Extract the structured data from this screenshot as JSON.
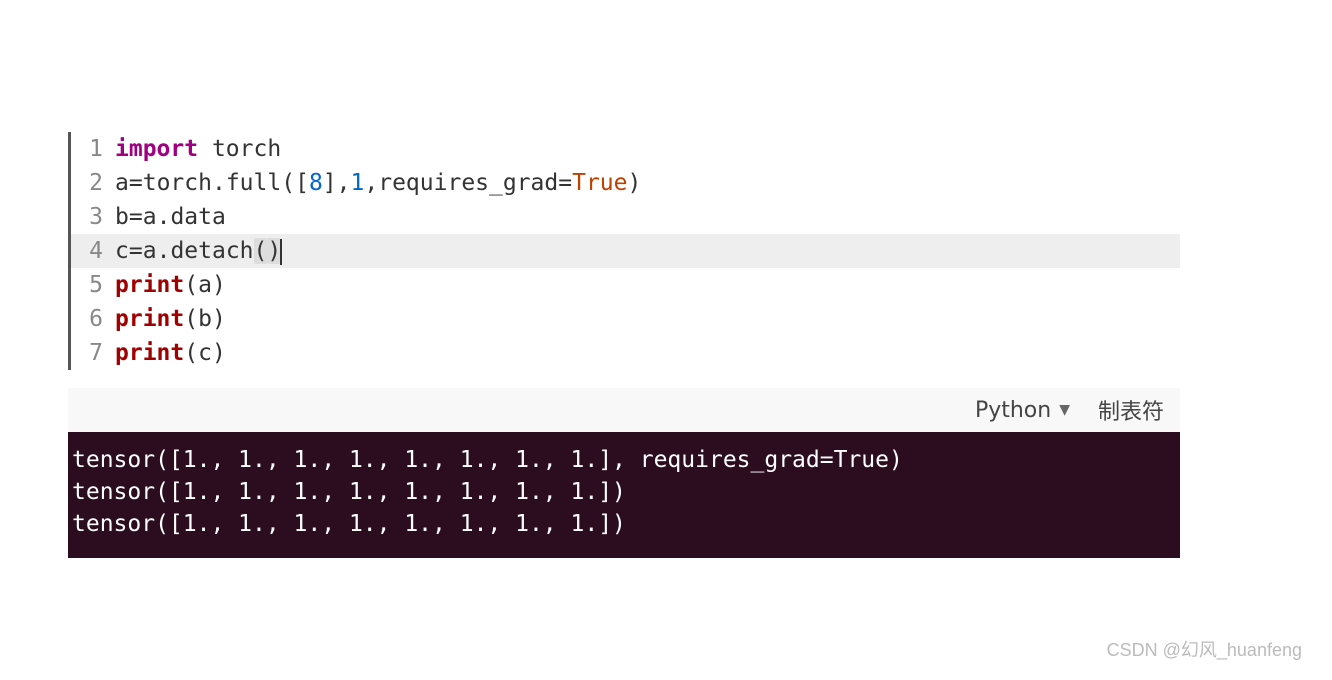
{
  "code": {
    "lines": [
      {
        "num": "1",
        "tokens": [
          {
            "t": "import ",
            "c": "kw-import"
          },
          {
            "t": "torch",
            "c": "ident"
          }
        ]
      },
      {
        "num": "2",
        "tokens": [
          {
            "t": "a",
            "c": "ident"
          },
          {
            "t": "=",
            "c": "eq"
          },
          {
            "t": "torch",
            "c": "ident"
          },
          {
            "t": ".",
            "c": "dot"
          },
          {
            "t": "full",
            "c": "ident"
          },
          {
            "t": "(",
            "c": "paren"
          },
          {
            "t": "[",
            "c": "paren"
          },
          {
            "t": "8",
            "c": "num"
          },
          {
            "t": "]",
            "c": "paren"
          },
          {
            "t": ",",
            "c": "paren"
          },
          {
            "t": "1",
            "c": "num"
          },
          {
            "t": ",",
            "c": "paren"
          },
          {
            "t": "requires_grad",
            "c": "ident"
          },
          {
            "t": "=",
            "c": "eq"
          },
          {
            "t": "True",
            "c": "bool"
          },
          {
            "t": ")",
            "c": "paren"
          }
        ]
      },
      {
        "num": "3",
        "tokens": [
          {
            "t": "b",
            "c": "ident"
          },
          {
            "t": "=",
            "c": "eq"
          },
          {
            "t": "a",
            "c": "ident"
          },
          {
            "t": ".",
            "c": "dot"
          },
          {
            "t": "data",
            "c": "ident"
          }
        ]
      },
      {
        "num": "4",
        "current": true,
        "tokens": [
          {
            "t": "c",
            "c": "ident"
          },
          {
            "t": "=",
            "c": "eq"
          },
          {
            "t": "a",
            "c": "ident"
          },
          {
            "t": ".",
            "c": "dot"
          },
          {
            "t": "detach",
            "c": "ident"
          },
          {
            "t": "(",
            "c": "paren bracket-hl"
          },
          {
            "t": ")",
            "c": "paren bracket-hl"
          }
        ],
        "cursor": true
      },
      {
        "num": "5",
        "tokens": [
          {
            "t": "print",
            "c": "kw-print"
          },
          {
            "t": "(",
            "c": "paren"
          },
          {
            "t": "a",
            "c": "ident"
          },
          {
            "t": ")",
            "c": "paren"
          }
        ]
      },
      {
        "num": "6",
        "tokens": [
          {
            "t": "print",
            "c": "kw-print"
          },
          {
            "t": "(",
            "c": "paren"
          },
          {
            "t": "b",
            "c": "ident"
          },
          {
            "t": ")",
            "c": "paren"
          }
        ]
      },
      {
        "num": "7",
        "tokens": [
          {
            "t": "print",
            "c": "kw-print"
          },
          {
            "t": "(",
            "c": "paren"
          },
          {
            "t": "c",
            "c": "ident"
          },
          {
            "t": ")",
            "c": "paren"
          }
        ]
      }
    ]
  },
  "statusbar": {
    "language": "Python",
    "tab_label": "制表符"
  },
  "terminal": {
    "lines": [
      "tensor([1., 1., 1., 1., 1., 1., 1., 1.], requires_grad=True)",
      "tensor([1., 1., 1., 1., 1., 1., 1., 1.])",
      "tensor([1., 1., 1., 1., 1., 1., 1., 1.])"
    ]
  },
  "watermark": "CSDN @幻风_huanfeng"
}
